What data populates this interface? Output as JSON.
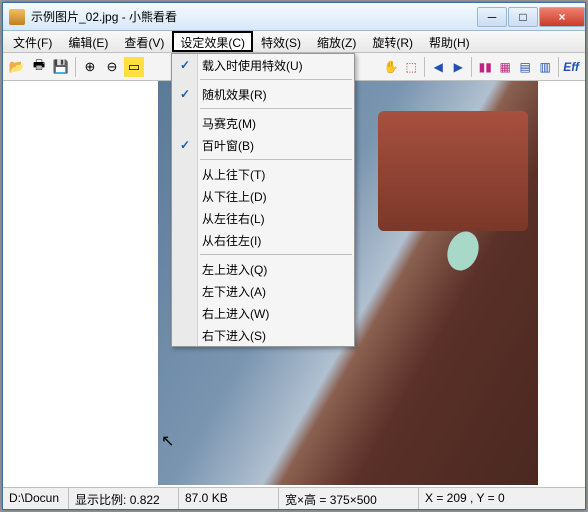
{
  "title": "示例图片_02.jpg - 小熊看看",
  "menubar": {
    "file": "文件(F)",
    "edit": "编辑(E)",
    "view": "查看(V)",
    "effect": "设定效果(C)",
    "special": "特效(S)",
    "zoom": "缩放(Z)",
    "rotate": "旋转(R)",
    "help": "帮助(H)"
  },
  "dropdown": {
    "use_on_load": "载入时使用特效(U)",
    "random": "随机效果(R)",
    "mosaic": "马赛克(M)",
    "blinds": "百叶窗(B)",
    "top_down": "从上往下(T)",
    "bottom_up": "从下往上(D)",
    "left_right": "从左往右(L)",
    "right_left": "从右往左(I)",
    "tl_enter": "左上进入(Q)",
    "bl_enter": "左下进入(A)",
    "tr_enter": "右上进入(W)",
    "br_enter": "右下进入(S)"
  },
  "status": {
    "path": "D:\\Docun",
    "zoom_label": "显示比例:",
    "zoom_val": "0.822",
    "filesize": "87.0 KB",
    "dims_label": "宽×高 =",
    "dims_val": "375×500",
    "pos_label": "X = 209 , Y = 0"
  },
  "eff_label": "Eff"
}
